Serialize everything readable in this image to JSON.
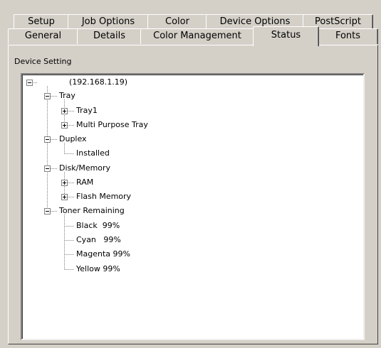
{
  "tabs": {
    "row1": [
      "Setup",
      "Job Options",
      "Color",
      "Device Options",
      "PostScript"
    ],
    "row2": [
      "General",
      "Details",
      "Color Management",
      "Status",
      "Fonts"
    ],
    "active": "Status"
  },
  "status": {
    "group_label": "Device Setting",
    "tree": {
      "root": "(192.168.1.19)",
      "tray": {
        "label": "Tray",
        "children": [
          "Tray1",
          "Multi Purpose Tray"
        ]
      },
      "duplex": {
        "label": "Duplex",
        "children": [
          "Installed"
        ]
      },
      "disk_memory": {
        "label": "Disk/Memory",
        "children": [
          "RAM",
          "Flash Memory"
        ]
      },
      "toner": {
        "label": "Toner Remaining",
        "children": [
          "Black  99%",
          "Cyan   99%",
          "Magenta 99%",
          "Yellow 99%"
        ]
      }
    }
  },
  "icons": {
    "expanded": "minus-box-icon",
    "collapsed": "plus-box-icon"
  }
}
